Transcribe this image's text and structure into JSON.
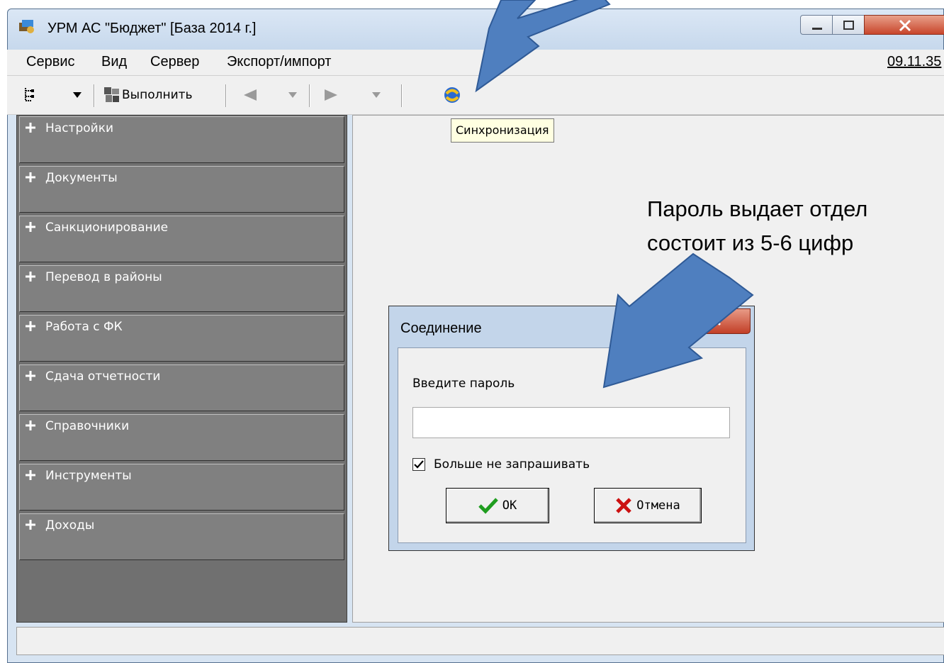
{
  "window": {
    "title": "УРМ АС \"Бюджет\" [База 2014 г.]"
  },
  "menu": {
    "items": [
      {
        "label": "Сервис",
        "accel": "С"
      },
      {
        "label": "Вид",
        "accel": "В"
      },
      {
        "label": "Сервер"
      },
      {
        "label": "Экспорт/импорт"
      }
    ],
    "clock": "09.11.35"
  },
  "toolbar": {
    "execute_label": "Выполнить",
    "tree_icon": "tree-view-icon",
    "back_icon": "back-arrow-icon",
    "forward_icon": "forward-arrow-icon",
    "sync_icon": "sync-icon"
  },
  "tooltip": {
    "text": "Синхронизация"
  },
  "sidebar": {
    "sections": [
      {
        "label": "Настройки"
      },
      {
        "label": "Документы"
      },
      {
        "label": "Санкционирование"
      },
      {
        "label": "Перевод в районы"
      },
      {
        "label": "Работа с ФК"
      },
      {
        "label": "Сдача отчетности"
      },
      {
        "label": "Справочники"
      },
      {
        "label": "Инструменты"
      },
      {
        "label": "Доходы"
      }
    ]
  },
  "annotation": {
    "line1": "Пароль выдает отдел",
    "line2": "состоит из 5-6 цифр",
    "arrow_color": "#4f7fbf"
  },
  "dialog": {
    "title": "Соединение",
    "prompt": "Введите пароль",
    "password_value": "",
    "remember_label": "Больше не запрашивать",
    "remember_checked": true,
    "ok_label": "OK",
    "cancel_label": "Отмена"
  },
  "colors": {
    "panel_gray": "#808080",
    "panel_text": "#ffffff",
    "tooltip_bg": "#ffffe1",
    "ok_check": "#1f9d1f",
    "cancel_x": "#cc1111"
  }
}
